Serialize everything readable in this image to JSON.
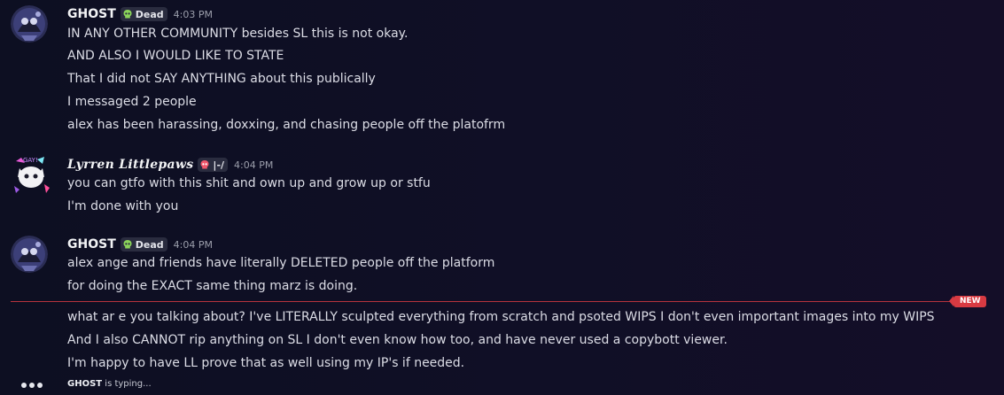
{
  "messages": [
    {
      "username": "GHOST",
      "tag": {
        "icon": "skull-icon",
        "label": "Dead",
        "color": "#8bd45a"
      },
      "time": "4:03 PM",
      "lines": [
        "IN ANY OTHER COMMUNITY besides SL this is not okay.",
        "AND ALSO I WOULD LIKE TO STATE",
        "That I did not SAY ANYTHING about this publically",
        "I messaged 2 people",
        "alex has been harassing, doxxing, and chasing people off the platofrm"
      ]
    },
    {
      "username": "Lyrren Littlepaws",
      "tag": {
        "icon": "pink-skull-icon",
        "label": "|-/",
        "color": "#f0566b"
      },
      "time": "4:04 PM",
      "lines": [
        "you can gtfo with this shit and own up and grow up or stfu",
        "I'm done with you"
      ]
    },
    {
      "username": "GHOST",
      "tag": {
        "icon": "skull-icon",
        "label": "Dead",
        "color": "#8bd45a"
      },
      "time": "4:04 PM",
      "lines": [
        "alex ange and friends have literally DELETED people off the platform",
        "for doing the EXACT same thing marz is doing.",
        "what ar e you talking about? I've LITERALLY sculpted everything from scratch and psoted WIPS I don't even important images into my WIPS",
        "And I also CANNOT rip anything on SL I don't even know how too, and have never used a copybott viewer.",
        "I'm happy to have LL prove that as well using my IP's if needed."
      ]
    }
  ],
  "new_divider": {
    "label": "NEW",
    "color": "#d83a42"
  },
  "typing": {
    "user": "GHOST",
    "text": "is typing..."
  }
}
